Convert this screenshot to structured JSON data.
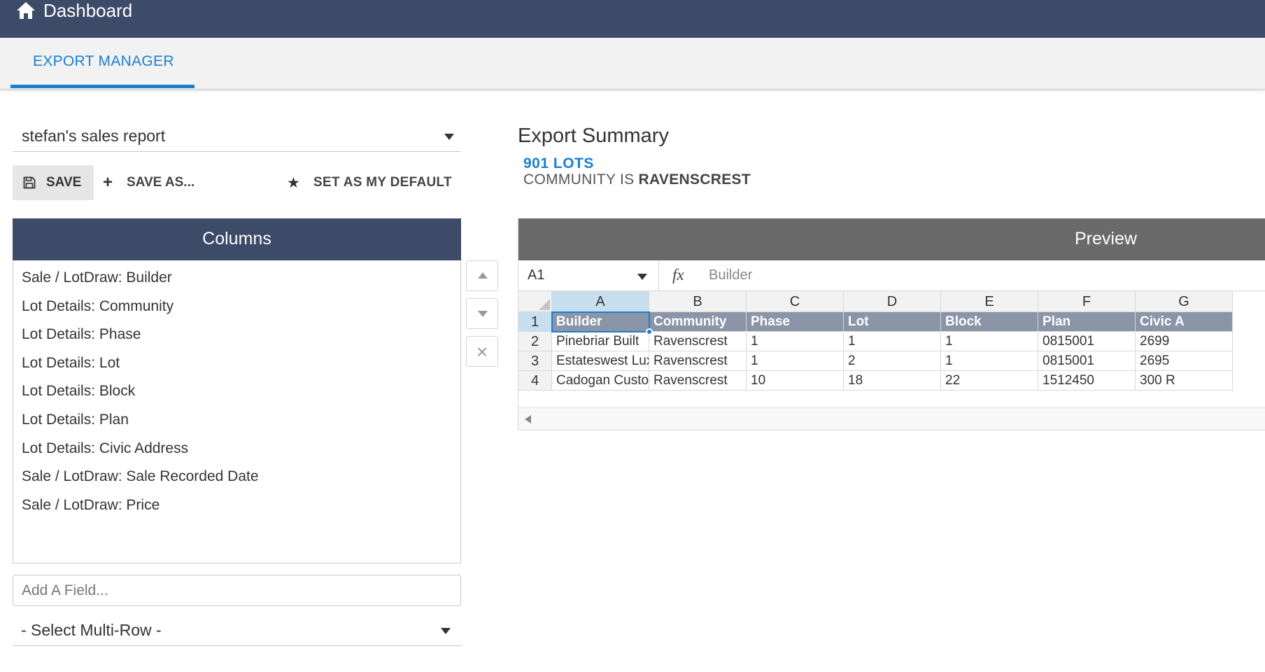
{
  "header": {
    "title": "Dashboard",
    "icon": "home-icon"
  },
  "tabs": [
    {
      "label": "EXPORT MANAGER",
      "active": true
    }
  ],
  "report_select": {
    "value": "stefan's sales report"
  },
  "toolbar": {
    "save_label": "SAVE",
    "save_as_label": "SAVE AS...",
    "default_label": "SET AS MY DEFAULT"
  },
  "columns_panel": {
    "title": "Columns",
    "items": [
      "Sale / LotDraw: Builder",
      "Lot Details: Community",
      "Lot Details: Phase",
      "Lot Details: Lot",
      "Lot Details: Block",
      "Lot Details: Plan",
      "Lot Details: Civic Address",
      "Sale / LotDraw: Sale Recorded Date",
      "Sale / LotDraw: Price"
    ]
  },
  "add_field": {
    "placeholder": "Add A Field..."
  },
  "multi_row": {
    "value": "- Select Multi-Row -"
  },
  "summary": {
    "title": "Export Summary",
    "lots": "901 LOTS",
    "filter_prefix": "COMMUNITY IS",
    "filter_value": "RAVENSCREST"
  },
  "preview": {
    "title": "Preview",
    "cell_ref": "A1",
    "formula_value": "Builder",
    "col_letters": [
      "A",
      "B",
      "C",
      "D",
      "E",
      "F",
      "G"
    ],
    "row_numbers": [
      "1",
      "2",
      "3",
      "4"
    ],
    "rows": [
      [
        "Builder",
        "Community",
        "Phase",
        "Lot",
        "Block",
        "Plan",
        "Civic A"
      ],
      [
        "Pinebriar Built",
        "Ravenscrest",
        "1",
        "1",
        "1",
        "0815001",
        "2699"
      ],
      [
        "Estateswest Luxury",
        "Ravenscrest",
        "1",
        "2",
        "1",
        "0815001",
        "2695"
      ],
      [
        "Cadogan Custom",
        "Ravenscrest",
        "10",
        "18",
        "22",
        "1512450",
        "300 R"
      ]
    ]
  },
  "colors": {
    "navbar": "#3d4a68",
    "accent": "#1a7fd0",
    "preview_header": "#6a6a6a",
    "grid_header_row": "#8b95a8"
  }
}
